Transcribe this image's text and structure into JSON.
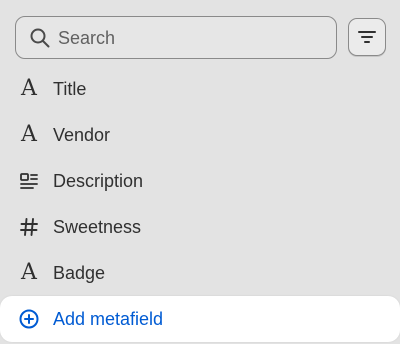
{
  "search": {
    "placeholder": "Search",
    "icon": "search-icon"
  },
  "filter": {
    "icon": "filter-lines-icon"
  },
  "fields": [
    {
      "label": "Title",
      "icon": "text-a-icon"
    },
    {
      "label": "Vendor",
      "icon": "text-a-icon"
    },
    {
      "label": "Description",
      "icon": "paragraph-image-icon"
    },
    {
      "label": "Sweetness",
      "icon": "hashtag-icon"
    },
    {
      "label": "Badge",
      "icon": "text-a-icon"
    }
  ],
  "add_metafield": {
    "label": "Add metafield",
    "icon": "plus-circle-icon"
  },
  "colors": {
    "background": "#e3e3e3",
    "text": "#303030",
    "accent": "#005bd3"
  }
}
